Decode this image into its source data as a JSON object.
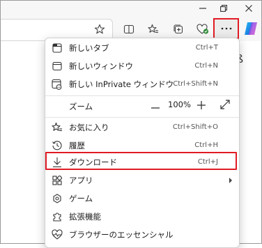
{
  "menu": {
    "new_tab": {
      "label": "新しいタブ",
      "shortcut": "Ctrl+T"
    },
    "new_window": {
      "label": "新しいウィンドウ",
      "shortcut": "Ctrl+N"
    },
    "new_inprivate": {
      "label": "新しい InPrivate ウィンドウ",
      "shortcut": "Ctrl+Shift+N"
    },
    "zoom": {
      "label": "ズーム",
      "value": "100%"
    },
    "favorites": {
      "label": "お気に入り",
      "shortcut": "Ctrl+Shift+O"
    },
    "history": {
      "label": "履歴",
      "shortcut": "Ctrl+H"
    },
    "downloads": {
      "label": "ダウンロード",
      "shortcut": "Ctrl+J"
    },
    "apps": {
      "label": "アプリ"
    },
    "games": {
      "label": "ゲーム"
    },
    "extensions": {
      "label": "拡張機能"
    },
    "browser_essentials": {
      "label": "ブラウザーのエッセンシャル"
    }
  },
  "colors": {
    "highlight": "#e01b24",
    "accent": "#0a7fd8"
  }
}
